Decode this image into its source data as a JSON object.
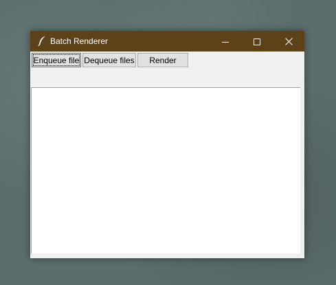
{
  "window": {
    "title": "Batch Renderer",
    "titlebar_color": "#5c4119",
    "icons": {
      "app": "feather-icon",
      "minimize": "minimize-icon",
      "maximize": "maximize-icon",
      "close": "close-icon"
    }
  },
  "toolbar": {
    "enqueue_label": "Enqueue file",
    "dequeue_label": "Dequeue files",
    "render_label": "Render"
  },
  "file_list": {
    "items": []
  }
}
